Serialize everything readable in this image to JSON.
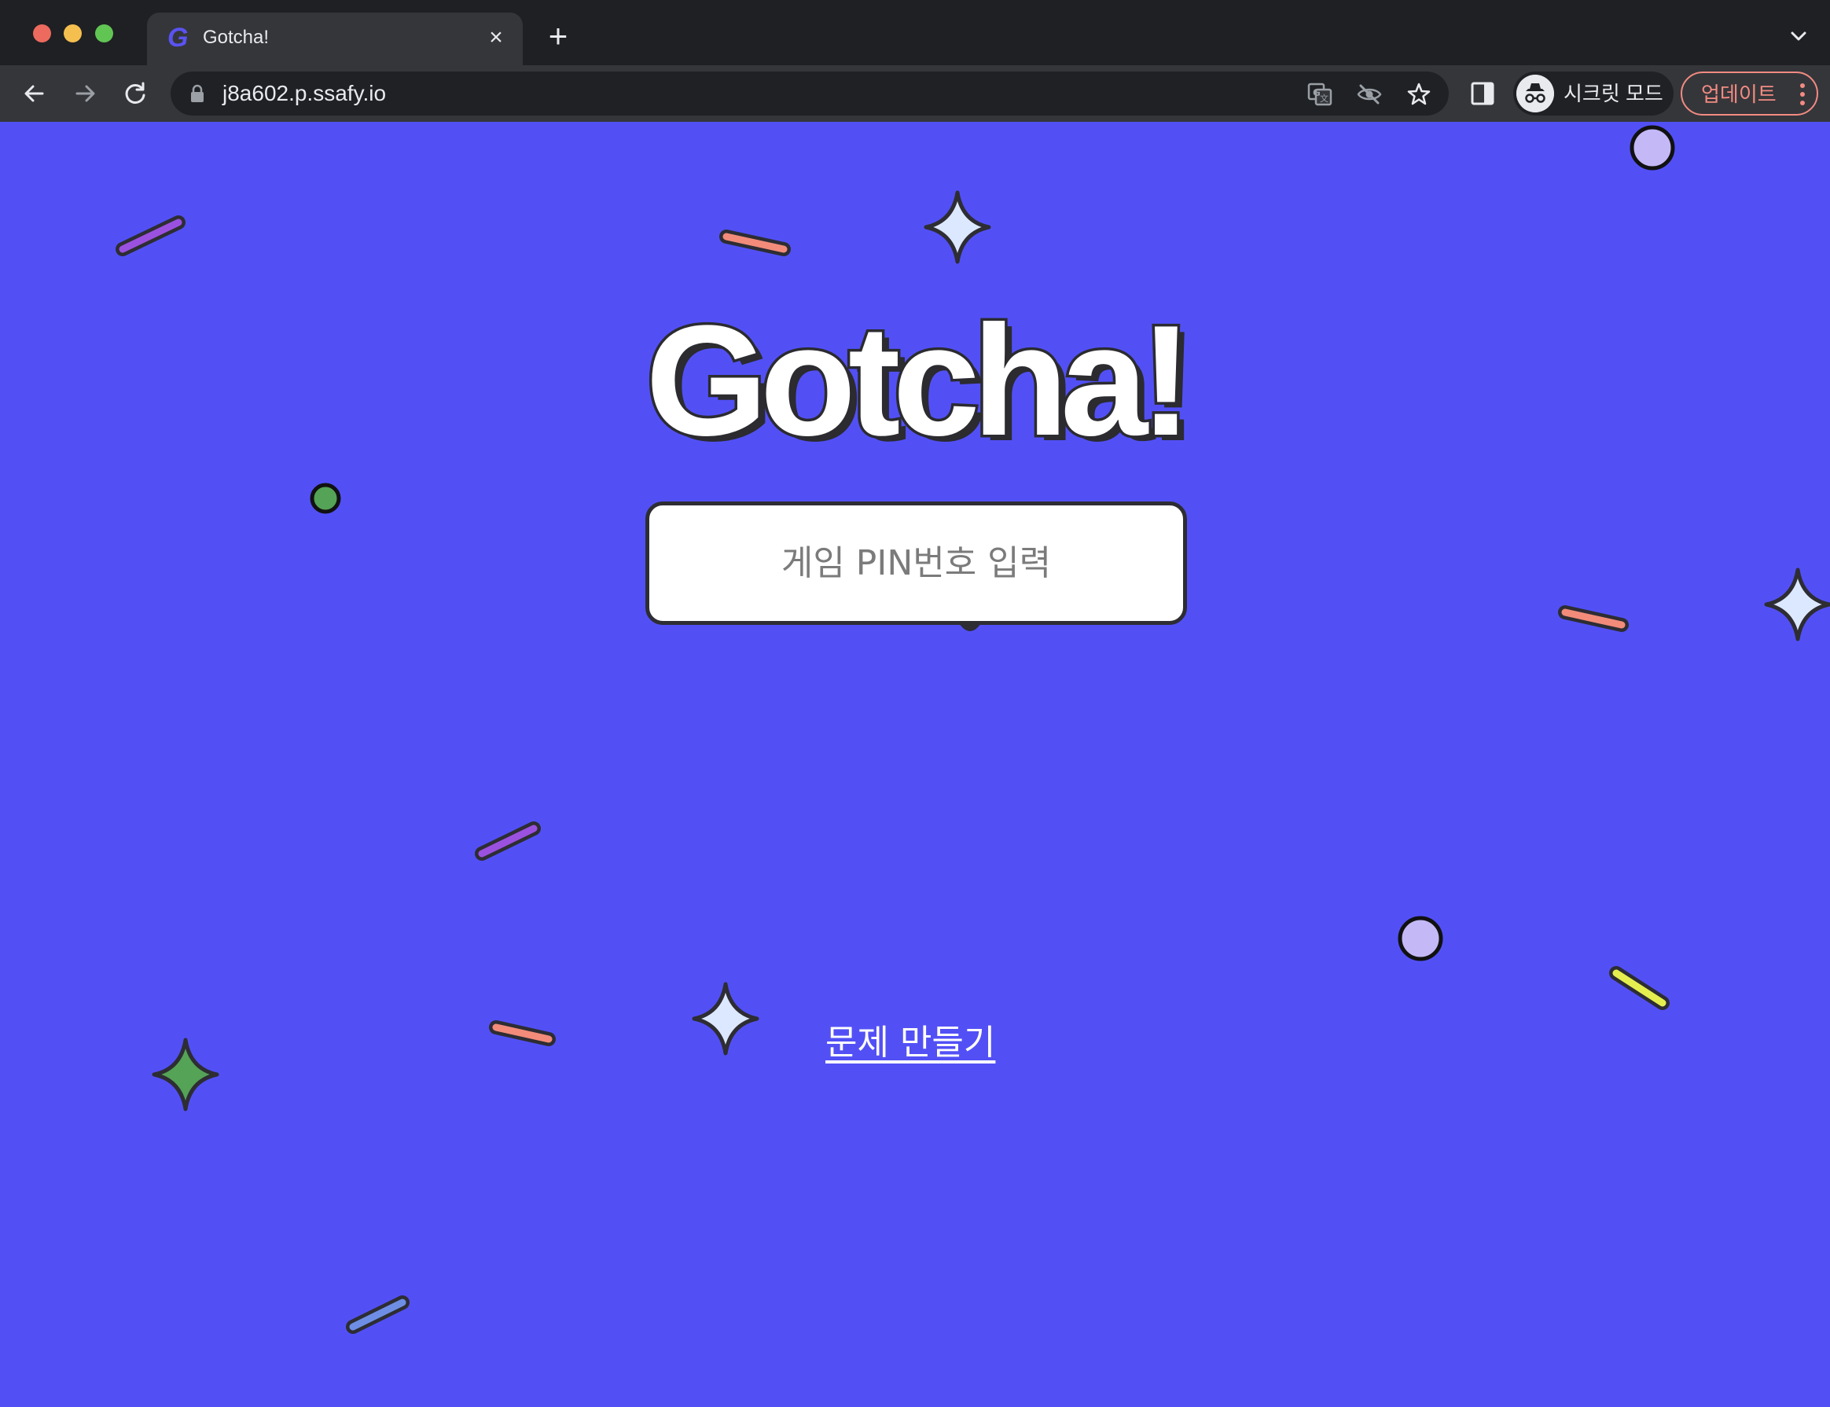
{
  "browser": {
    "tab": {
      "title": "Gotcha!",
      "favicon_letter": "G"
    },
    "address": {
      "url": "j8a602.p.ssafy.io"
    },
    "incognito_label": "시크릿 모드",
    "update_label": "업데이트",
    "icons": [
      "back-icon",
      "forward-icon",
      "reload-icon",
      "lock-icon",
      "translate-icon",
      "eye-off-icon",
      "star-icon",
      "side-panel-icon",
      "incognito-icon",
      "more-icon"
    ]
  },
  "page": {
    "logo": "Gotcha!",
    "pin_placeholder": "게임 PIN번호 입력",
    "make_quiz_link": "문제 만들기"
  },
  "colors": {
    "background": "#5250f5",
    "purple": "#9b51e0",
    "salmon": "#f28b7a",
    "lavender": "#c4b8f7",
    "ice": "#dce8ff",
    "green": "#54a356",
    "lime": "#e4ef4f",
    "blue": "#6e8ee6",
    "outline": "#2d2d33"
  }
}
